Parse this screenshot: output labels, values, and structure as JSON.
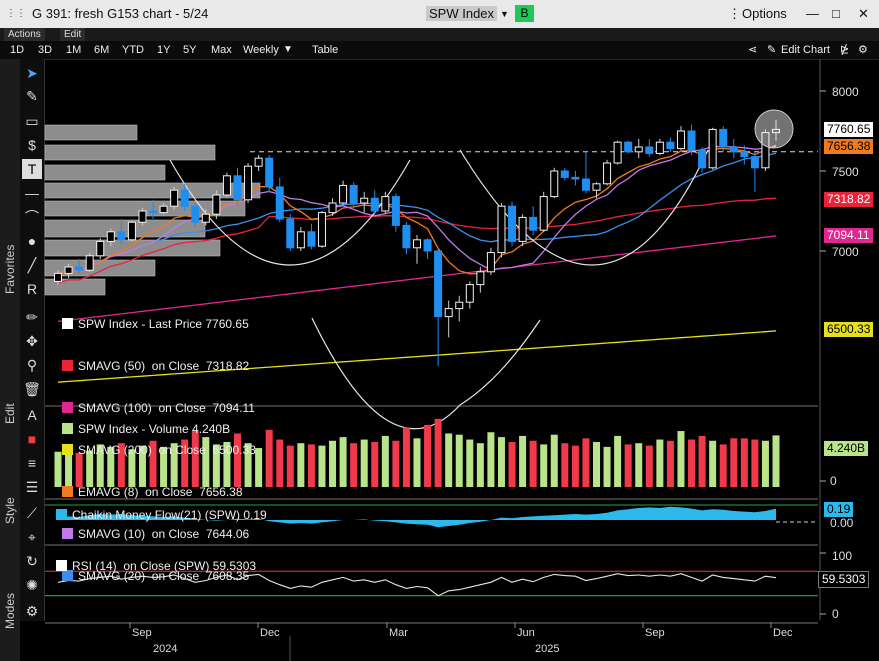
{
  "window": {
    "title": "G 391: fresh G153 chart - 5/24",
    "security": "SPW Index",
    "badge": "B",
    "options_label": "Options",
    "minimize": "—",
    "maximize": "□",
    "close": "✕"
  },
  "menus": [
    "Actions",
    "Edit"
  ],
  "ranges": [
    "1D",
    "3D",
    "1M",
    "6M",
    "YTD",
    "1Y",
    "5Y",
    "Max"
  ],
  "period": "Weekly",
  "table_label": "Table",
  "edit_chart_label": "Edit Chart",
  "side_labels": {
    "favorites": "Favorites",
    "edit": "Edit",
    "style": "Style",
    "modes": "Modes"
  },
  "colors": {
    "up": "#f2f2f2",
    "down": "#1f8ef1",
    "sma50": "#e8233a",
    "sma100": "#e0268f",
    "sma200": "#e6e01a",
    "ema8": "#f07a1e",
    "sma10": "#c07ae8",
    "sma20": "#3b8eea",
    "vol_up": "#b9e48a",
    "vol_down": "#f0394a",
    "cmf": "#2cb9ec"
  },
  "legend": [
    {
      "label": "SPW Index - Last Price 7760.65",
      "color": "#ffffff"
    },
    {
      "label": "SMAVG (50)  on Close  7318.82",
      "color": "#e8233a"
    },
    {
      "label": "SMAVG (100)  on Close  7094.11",
      "color": "#e0268f"
    },
    {
      "label": "SMAVG (200)  on Close  6500.33",
      "color": "#e6e01a"
    },
    {
      "label": "EMAVG (8)  on Close  7656.38",
      "color": "#f07a1e"
    },
    {
      "label": "SMAVG (10)  on Close  7644.06",
      "color": "#c07ae8"
    },
    {
      "label": "SMAVG (20)  on Close  7608.35",
      "color": "#3b8eea"
    }
  ],
  "price_labels": [
    {
      "value": "7760.65",
      "bg": "#ffffff",
      "fg": "#000000"
    },
    {
      "value": "7656.38",
      "bg": "#f07a1e",
      "fg": "#000000"
    },
    {
      "value": "7318.82",
      "bg": "#e8233a",
      "fg": "#ffffff"
    },
    {
      "value": "7094.11",
      "bg": "#e0268f",
      "fg": "#ffffff"
    },
    {
      "value": "6500.33",
      "bg": "#e6e01a",
      "fg": "#000000"
    }
  ],
  "volume_legend": "SPW Index - Volume 4.240B",
  "volume_label": "4.240B",
  "cmf_legend": "Chaikin Money Flow(21) (SPW) 0.19",
  "cmf_labels": [
    "0.19",
    "0.00"
  ],
  "rsi_legend": "RSI (14)  on Close (SPW) 59.5303",
  "rsi_label": "59.5303",
  "chart_data": {
    "type": "candlestick",
    "period": "weekly",
    "price_axis": {
      "ticks": [
        8000,
        7500,
        7000
      ],
      "ylim": [
        6200,
        8200
      ]
    },
    "volume_axis": {
      "ticks": [
        0
      ],
      "last": "4.240B"
    },
    "cmf_axis": {
      "ticks": [
        "0.19",
        "0.00"
      ]
    },
    "rsi_axis": {
      "ticks": [
        100,
        50,
        0
      ],
      "overbought": 70,
      "oversold": 30,
      "last": 59.5303
    },
    "x_ticks": [
      "Sep",
      "Dec",
      "Mar",
      "Jun",
      "Sep",
      "Dec"
    ],
    "years": [
      "2024",
      "2025"
    ],
    "last_price": 7760.65,
    "sma50": 7318.82,
    "sma100": 7094.11,
    "sma200": 6500.33,
    "ema8": 7656.38,
    "sma10": 7644.06,
    "sma20": 7608.35,
    "cmf": 0.19,
    "rsi": 59.5303,
    "candles": [
      [
        6810,
        6880,
        6790,
        6860
      ],
      [
        6860,
        6920,
        6830,
        6900
      ],
      [
        6900,
        6950,
        6860,
        6880
      ],
      [
        6880,
        6990,
        6870,
        6970
      ],
      [
        6970,
        7080,
        6950,
        7060
      ],
      [
        7060,
        7140,
        7030,
        7120
      ],
      [
        7120,
        7200,
        7040,
        7070
      ],
      [
        7070,
        7190,
        7060,
        7180
      ],
      [
        7180,
        7270,
        7160,
        7250
      ],
      [
        7250,
        7320,
        7200,
        7240
      ],
      [
        7240,
        7300,
        7230,
        7280
      ],
      [
        7280,
        7400,
        7260,
        7380
      ],
      [
        7380,
        7420,
        7250,
        7280
      ],
      [
        7280,
        7300,
        7150,
        7180
      ],
      [
        7180,
        7260,
        7160,
        7230
      ],
      [
        7230,
        7380,
        7200,
        7350
      ],
      [
        7350,
        7490,
        7340,
        7470
      ],
      [
        7470,
        7520,
        7290,
        7320
      ],
      [
        7320,
        7550,
        7300,
        7530
      ],
      [
        7530,
        7600,
        7500,
        7580
      ],
      [
        7580,
        7600,
        7370,
        7400
      ],
      [
        7400,
        7460,
        7180,
        7200
      ],
      [
        7200,
        7230,
        7000,
        7020
      ],
      [
        7020,
        7150,
        7000,
        7120
      ],
      [
        7120,
        7170,
        7010,
        7030
      ],
      [
        7030,
        7250,
        7020,
        7240
      ],
      [
        7240,
        7330,
        7220,
        7300
      ],
      [
        7300,
        7440,
        7290,
        7410
      ],
      [
        7410,
        7430,
        7270,
        7300
      ],
      [
        7300,
        7370,
        7240,
        7330
      ],
      [
        7330,
        7380,
        7220,
        7250
      ],
      [
        7250,
        7370,
        7230,
        7340
      ],
      [
        7340,
        7360,
        7120,
        7160
      ],
      [
        7160,
        7180,
        6980,
        7020
      ],
      [
        7020,
        7100,
        6920,
        7070
      ],
      [
        7070,
        7080,
        6950,
        7000
      ],
      [
        7000,
        7010,
        6280,
        6590
      ],
      [
        6590,
        6690,
        6460,
        6640
      ],
      [
        6640,
        6720,
        6560,
        6680
      ],
      [
        6680,
        6810,
        6640,
        6790
      ],
      [
        6790,
        6900,
        6740,
        6870
      ],
      [
        6870,
        7020,
        6850,
        6990
      ],
      [
        6990,
        7300,
        6960,
        7280
      ],
      [
        7280,
        7310,
        7030,
        7060
      ],
      [
        7060,
        7230,
        7030,
        7210
      ],
      [
        7210,
        7280,
        7100,
        7130
      ],
      [
        7130,
        7370,
        7120,
        7340
      ],
      [
        7340,
        7520,
        7330,
        7500
      ],
      [
        7500,
        7520,
        7440,
        7460
      ],
      [
        7460,
        7500,
        7410,
        7450
      ],
      [
        7450,
        7620,
        7360,
        7380
      ],
      [
        7380,
        7430,
        7330,
        7420
      ],
      [
        7420,
        7570,
        7410,
        7550
      ],
      [
        7550,
        7690,
        7540,
        7680
      ],
      [
        7680,
        7690,
        7610,
        7620
      ],
      [
        7620,
        7700,
        7580,
        7650
      ],
      [
        7650,
        7700,
        7590,
        7610
      ],
      [
        7610,
        7700,
        7600,
        7680
      ],
      [
        7680,
        7710,
        7620,
        7640
      ],
      [
        7640,
        7780,
        7630,
        7750
      ],
      [
        7750,
        7790,
        7600,
        7630
      ],
      [
        7630,
        7650,
        7490,
        7520
      ],
      [
        7520,
        7770,
        7510,
        7760
      ],
      [
        7760,
        7780,
        7620,
        7650
      ],
      [
        7650,
        7700,
        7580,
        7620
      ],
      [
        7620,
        7660,
        7540,
        7590
      ],
      [
        7590,
        7620,
        7370,
        7520
      ],
      [
        7520,
        7760,
        7500,
        7740
      ],
      [
        7740,
        7820,
        7690,
        7760
      ]
    ],
    "volume": [
      2.9,
      3.2,
      2.8,
      3.0,
      3.5,
      3.3,
      3.6,
      3.1,
      3.4,
      3.8,
      3.3,
      3.6,
      3.9,
      4.6,
      4.1,
      3.5,
      3.7,
      4.4,
      3.6,
      3.2,
      4.7,
      3.9,
      3.4,
      3.6,
      3.5,
      3.4,
      3.8,
      4.1,
      3.6,
      3.9,
      3.7,
      4.2,
      3.8,
      4.9,
      4.0,
      5.1,
      5.6,
      4.4,
      4.3,
      3.9,
      3.6,
      4.5,
      4.1,
      3.7,
      4.2,
      3.8,
      3.5,
      4.3,
      3.6,
      3.4,
      4.0,
      3.7,
      3.3,
      4.2,
      3.5,
      3.6,
      3.4,
      3.9,
      3.8,
      4.6,
      3.9,
      4.2,
      3.8,
      3.5,
      4.0,
      4.0,
      3.9,
      3.8,
      4.24
    ],
    "cmf_series": [
      0.04,
      0.06,
      0.05,
      0.08,
      0.1,
      0.09,
      0.1,
      0.08,
      0.07,
      0.06,
      0.05,
      0.06,
      0.04,
      0.02,
      0.0,
      -0.01,
      0.0,
      0.02,
      0.01,
      0.02,
      -0.02,
      -0.04,
      -0.06,
      -0.05,
      -0.06,
      -0.04,
      -0.02,
      0.0,
      0.0,
      0.01,
      -0.01,
      -0.02,
      -0.04,
      -0.06,
      -0.07,
      -0.08,
      -0.12,
      -0.1,
      -0.08,
      -0.05,
      -0.03,
      0.0,
      0.04,
      0.03,
      0.05,
      0.06,
      0.07,
      0.08,
      0.09,
      0.1,
      0.09,
      0.1,
      0.12,
      0.16,
      0.18,
      0.2,
      0.21,
      0.2,
      0.22,
      0.21,
      0.19,
      0.16,
      0.18,
      0.17,
      0.15,
      0.14,
      0.13,
      0.15,
      0.19
    ],
    "rsi_series": [
      52,
      55,
      54,
      58,
      60,
      62,
      57,
      60,
      62,
      60,
      61,
      64,
      58,
      52,
      55,
      60,
      64,
      56,
      63,
      65,
      55,
      48,
      42,
      46,
      44,
      52,
      56,
      60,
      54,
      56,
      52,
      56,
      48,
      42,
      45,
      43,
      30,
      38,
      40,
      44,
      48,
      52,
      60,
      52,
      57,
      53,
      60,
      65,
      63,
      62,
      55,
      58,
      62,
      66,
      63,
      64,
      62,
      64,
      62,
      66,
      60,
      54,
      64,
      60,
      58,
      56,
      54,
      62,
      59.53
    ]
  }
}
